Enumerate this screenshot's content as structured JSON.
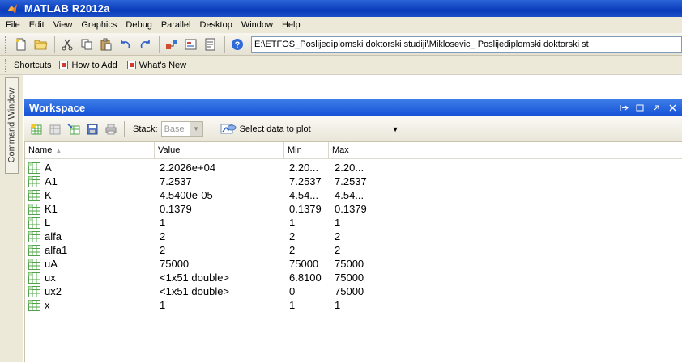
{
  "window": {
    "title": "MATLAB  R2012a"
  },
  "menu": [
    "File",
    "Edit",
    "View",
    "Graphics",
    "Debug",
    "Parallel",
    "Desktop",
    "Window",
    "Help"
  ],
  "toolbar": {
    "icons": [
      "new-file-icon",
      "open-folder-icon",
      "cut-icon",
      "copy-icon",
      "paste-icon",
      "undo-icon",
      "redo-icon",
      "simulink-icon",
      "guide-icon",
      "profiler-icon",
      "help-icon"
    ],
    "current_folder": "E:\\ETFOS_Poslijediplomski doktorski studiji\\Miklosevic_ Poslijediplomski doktorski st"
  },
  "shortcuts": {
    "label": "Shortcuts",
    "items": [
      "How to Add",
      "What's New"
    ]
  },
  "command_window_tab": "Command Window",
  "workspace": {
    "title": "Workspace",
    "stack_label": "Stack:",
    "stack_value": "Base",
    "plot_button": "Select data to plot",
    "columns": {
      "name": "Name",
      "value": "Value",
      "min": "Min",
      "max": "Max"
    },
    "rows": [
      {
        "name": "A",
        "value": "2.2026e+04",
        "min": "2.20...",
        "max": "2.20..."
      },
      {
        "name": "A1",
        "value": "7.2537",
        "min": "7.2537",
        "max": "7.2537"
      },
      {
        "name": "K",
        "value": "4.5400e-05",
        "min": "4.54...",
        "max": "4.54..."
      },
      {
        "name": "K1",
        "value": "0.1379",
        "min": "0.1379",
        "max": "0.1379"
      },
      {
        "name": "L",
        "value": "1",
        "min": "1",
        "max": "1"
      },
      {
        "name": "alfa",
        "value": "2",
        "min": "2",
        "max": "2"
      },
      {
        "name": "alfa1",
        "value": "2",
        "min": "2",
        "max": "2"
      },
      {
        "name": "uA",
        "value": "75000",
        "min": "75000",
        "max": "75000"
      },
      {
        "name": "ux",
        "value": "<1x51 double>",
        "min": "6.8100",
        "max": "75000"
      },
      {
        "name": "ux2",
        "value": "<1x51 double>",
        "min": "0",
        "max": "75000"
      },
      {
        "name": "x",
        "value": "1",
        "min": "1",
        "max": "1"
      }
    ]
  },
  "colors": {
    "title_bar": "#0a3cba",
    "panel_bar": "#2a67e0",
    "chrome": "#ece9d8",
    "variable_icon": "#4fa447"
  }
}
